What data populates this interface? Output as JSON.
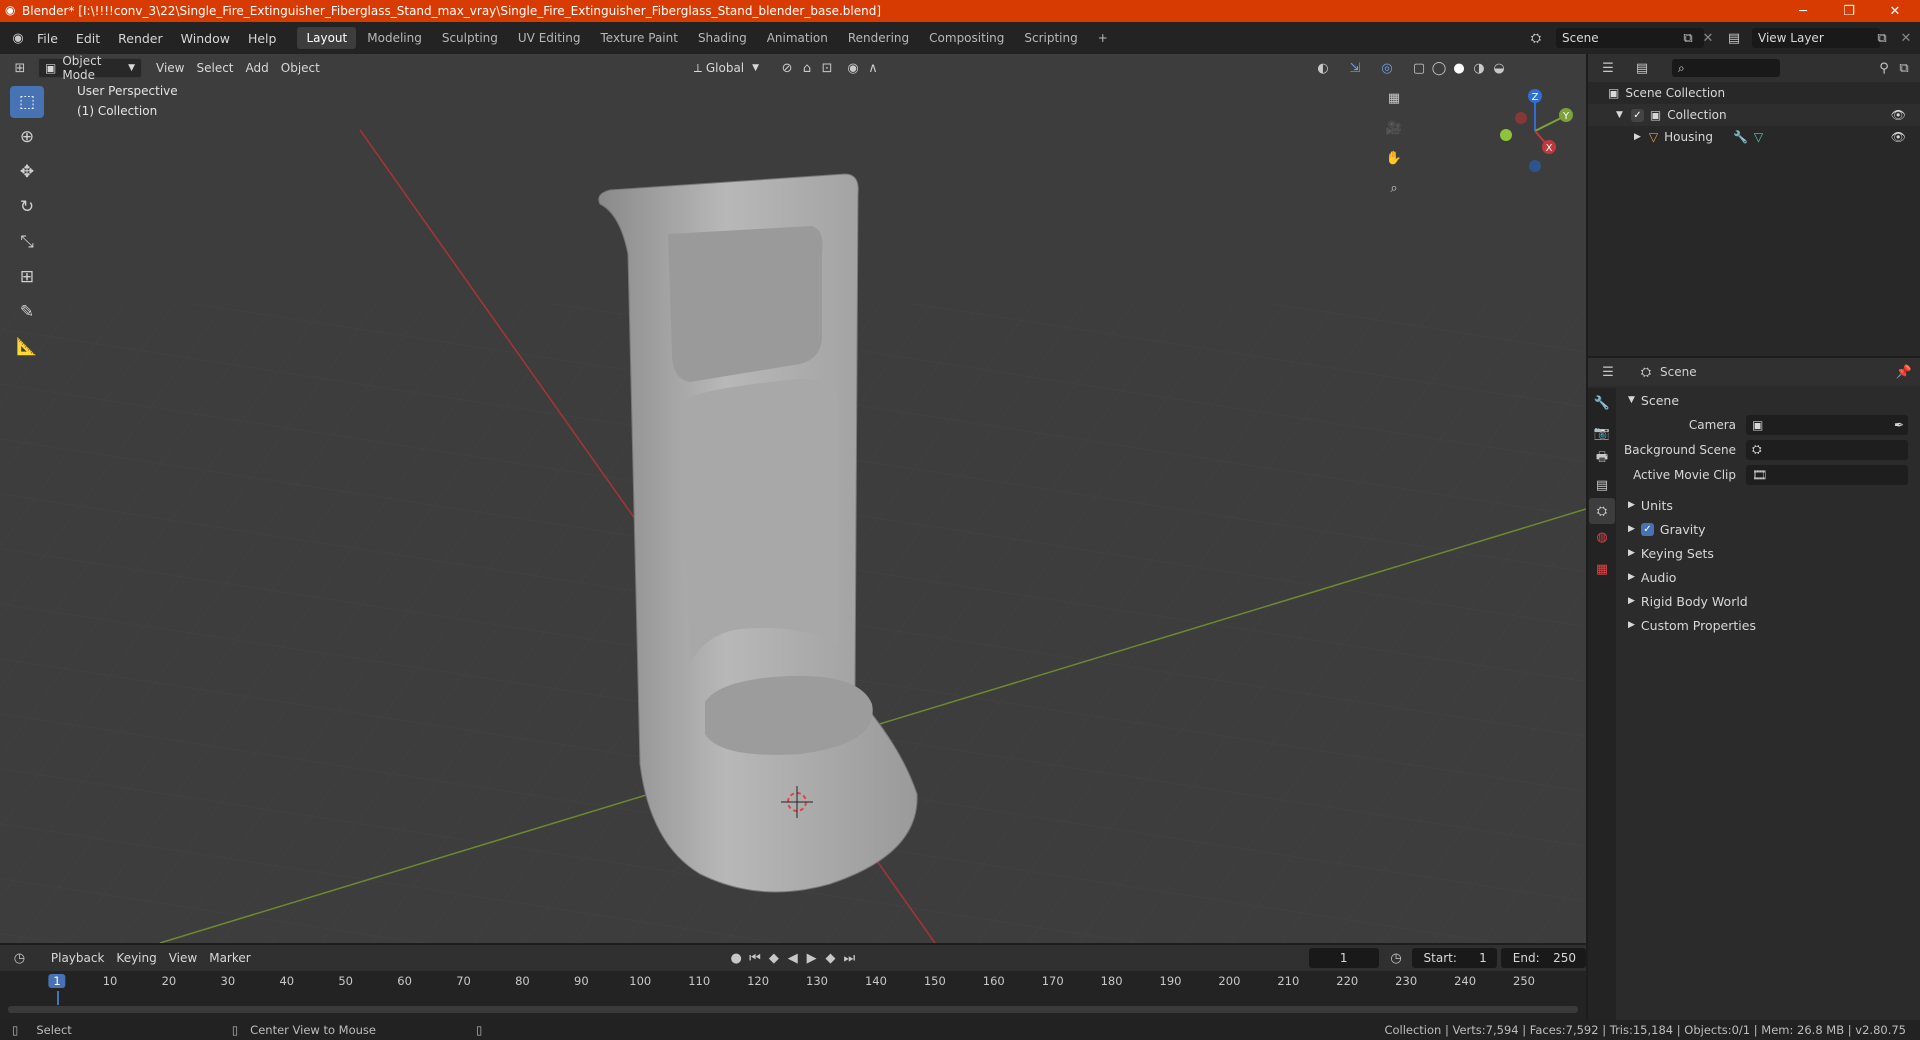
{
  "title": "Blender* [I:\\!!!!conv_3\\22\\Single_Fire_Extinguisher_Fiberglass_Stand_max_vray\\Single_Fire_Extinguisher_Fiberglass_Stand_blender_base.blend]",
  "menu": [
    "File",
    "Edit",
    "Render",
    "Window",
    "Help"
  ],
  "workspaces": [
    "Layout",
    "Modeling",
    "Sculpting",
    "UV Editing",
    "Texture Paint",
    "Shading",
    "Animation",
    "Rendering",
    "Compositing",
    "Scripting"
  ],
  "scene_name": "Scene",
  "view_layer": "View Layer",
  "viewport": {
    "mode": "Object Mode",
    "menus": [
      "View",
      "Select",
      "Add",
      "Object"
    ],
    "transform": "Global",
    "perspective_label": "User Perspective",
    "collection_label": "(1) Collection",
    "axes": {
      "x": "X",
      "y": "Y",
      "z": "Z"
    }
  },
  "outliner": {
    "root": "Scene Collection",
    "collection": "Collection",
    "object": "Housing"
  },
  "properties": {
    "header": "Scene",
    "panel": "Scene",
    "camera_label": "Camera",
    "bg_scene_label": "Background Scene",
    "movie_clip_label": "Active Movie Clip",
    "subpanels": [
      "Units",
      "Gravity",
      "Keying Sets",
      "Audio",
      "Rigid Body World",
      "Custom Properties"
    ]
  },
  "timeline": {
    "menus": [
      "Playback",
      "Keying",
      "View",
      "Marker"
    ],
    "current_frame": "1",
    "start_label": "Start:",
    "start": "1",
    "end_label": "End:",
    "end": "250",
    "ticks": [
      "1",
      "10",
      "20",
      "30",
      "40",
      "50",
      "60",
      "70",
      "80",
      "90",
      "100",
      "110",
      "120",
      "130",
      "140",
      "150",
      "160",
      "170",
      "180",
      "190",
      "200",
      "210",
      "220",
      "230",
      "240",
      "250"
    ]
  },
  "status": {
    "select": "Select",
    "center": "Center View to Mouse",
    "stats": "Collection | Verts:7,594 | Faces:7,592 | Tris:15,184 | Objects:0/1 | Mem: 26.8 MB | v2.80.75"
  },
  "colors": {
    "titlebar": "#d83b01",
    "accent": "#4772b3",
    "x_axis": "#c0383c",
    "y_axis": "#7da13b"
  }
}
